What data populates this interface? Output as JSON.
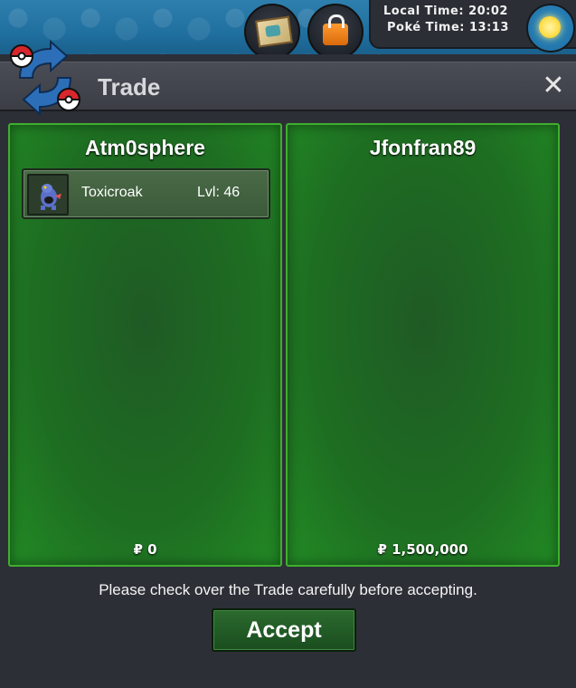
{
  "hud": {
    "local_time_label": "Local Time:",
    "local_time_value": "20:02",
    "poke_time_label": "Poké Time:",
    "poke_time_value": "13:13",
    "icons": [
      "map-icon",
      "bag-icon",
      "sun-icon"
    ]
  },
  "window": {
    "title": "Trade",
    "close_glyph": "✕"
  },
  "left_panel": {
    "player": "Atm0sphere",
    "items": [
      {
        "icon": "toxicroak-icon",
        "name": "Toxicroak",
        "level": "Lvl: 46"
      }
    ],
    "money": "₽ 0"
  },
  "right_panel": {
    "player": "Jfonfran89",
    "items": [],
    "money": "₽ 1,500,000"
  },
  "notice": "Please check over the Trade carefully before accepting.",
  "accept_label": "Accept",
  "colors": {
    "panel_green": "#1e6e22",
    "panel_border": "#3fae2f",
    "window_bg": "#2d2f37"
  }
}
